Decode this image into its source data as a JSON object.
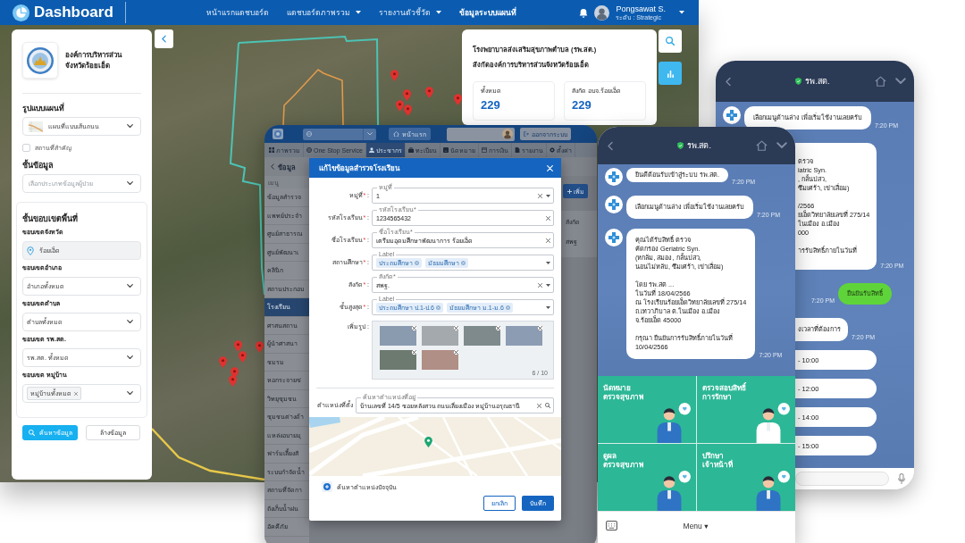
{
  "dashboard": {
    "title": "Dashboard",
    "nav": [
      {
        "label": "หน้าแรกแดชบอร์ด",
        "dropdown": false,
        "selected": false
      },
      {
        "label": "แดชบอร์ดภาพรวม",
        "dropdown": true,
        "selected": false
      },
      {
        "label": "รายงานตัวชี้วัด",
        "dropdown": true,
        "selected": false
      },
      {
        "label": "ข้อมูลระบบแผนที่",
        "dropdown": false,
        "selected": true
      }
    ],
    "user": {
      "name": "Pongsawat S.",
      "role": "ระดับ : Strategic"
    },
    "panel": {
      "org_name": "องค์การบริหารส่วน\nจังหวัดร้อยเอ็ด",
      "map_style": {
        "label": "รูปแบบแผนที่",
        "value": "แผนที่แบบเส้นถนน"
      },
      "landmarks": {
        "label": "สถานที่สำคัญ",
        "checked": false
      },
      "layer": {
        "label": "ชั้นข้อมูล",
        "placeholder": "เลือกประเภทข้อมูลผู้ป่วย"
      },
      "boundary": {
        "title": "ชั้นขอบเขตพื้นที่",
        "fields": [
          {
            "kind": "fixed",
            "label": "ขอบเขตจังหวัด",
            "value": "ร้อยเอ็ด"
          },
          {
            "kind": "select",
            "label": "ขอบเขตอำเภอ",
            "value": "อำเภอทั้งหมด"
          },
          {
            "kind": "select",
            "label": "ขอบเขตตำบล",
            "value": "ตำบลทั้งหมด"
          },
          {
            "kind": "select",
            "label": "ขอบเขต รพ.สต.",
            "value": "รพ.สต. ทั้งหมด"
          },
          {
            "kind": "chips",
            "label": "ขอบเขต หมู่บ้าน",
            "chips": [
              "หมู่บ้านทั้งหมด"
            ]
          }
        ]
      },
      "buttons": [
        {
          "kind": "primary",
          "label": "ค้นหาข้อมูล"
        },
        {
          "kind": "secondary",
          "label": "ล้างข้อมูล"
        }
      ]
    },
    "info_card": {
      "title": "โรงพยาบาลส่งเสริมสุขภาพตำบล (รพ.สต.)\nสังกัดองค์การบริหารส่วนจังหวัดร้อยเอ็ด",
      "stats": [
        {
          "label": "ทั้งหมด",
          "value": "229"
        },
        {
          "label": "สังกัด อบจ.ร้อยเอ็ด",
          "value": "229"
        }
      ]
    }
  },
  "web_app": {
    "home_button": "หน้าแรก",
    "logout_button": "ออกจากระบบ",
    "tabs": [
      {
        "label": "ภาพรวม",
        "selected": false
      },
      {
        "label": "One Stop Service",
        "selected": false
      },
      {
        "label": "ประชากร",
        "selected": true
      },
      {
        "label": "ทะเบียน",
        "selected": false
      },
      {
        "label": "นัดหมาย",
        "selected": false
      },
      {
        "label": "การเงิน",
        "selected": false
      },
      {
        "label": "รายงาน",
        "selected": false
      },
      {
        "label": "ตั้งค่า",
        "selected": false
      }
    ],
    "page_title": "ข้อมูล",
    "menu_header": "เมนู",
    "menu": [
      {
        "label": "ข้อมูลสำรวจ",
        "selected": false
      },
      {
        "label": "แพทย์ประจำ",
        "selected": false
      },
      {
        "label": "ศูนย์สาธารณ",
        "selected": false
      },
      {
        "label": "ศูนย์พัฒนาเ",
        "selected": false
      },
      {
        "label": "คลินิก",
        "selected": false
      },
      {
        "label": "สถานประกอบ",
        "selected": false
      },
      {
        "label": "โรงเรียน",
        "selected": true
      },
      {
        "label": "ศาสนสถาน",
        "selected": false
      },
      {
        "label": "ผู้นำศาสนา",
        "selected": false
      },
      {
        "label": "ชมรม",
        "selected": false
      },
      {
        "label": "หอกระจายข่",
        "selected": false
      },
      {
        "label": "วิทยุชุมชน",
        "selected": false
      },
      {
        "label": "ชุมชนต่างด้า",
        "selected": false
      },
      {
        "label": "แหล่งอบายมุ",
        "selected": false
      },
      {
        "label": "ฟาร์มเลี้ยงสั",
        "selected": false
      },
      {
        "label": "ระบบกำจัดน้ำ",
        "selected": false
      },
      {
        "label": "สถานที่จัดกา",
        "selected": false
      },
      {
        "label": "ถังเก็บน้ำฝน",
        "selected": false
      },
      {
        "label": "อัคคีภัย",
        "selected": false
      }
    ],
    "add_button": "เพิ่ม",
    "table": {
      "columns": [
        "สังกัด"
      ],
      "rows": [
        [
          "สพฐ"
        ]
      ]
    },
    "modal": {
      "title": "แก้ไขข้อมูลสำรวจโรงเรียน",
      "fields": [
        {
          "kind": "select",
          "label": "หมู่ที่",
          "mark": "*",
          "colon": ":",
          "float_label": "หมู่ที่",
          "value": "1"
        },
        {
          "kind": "text",
          "label": "รหัสโรงเรียน",
          "mark": "*",
          "colon": ":",
          "float_label": "รหัสโรงเรียน*",
          "value": "1234565432"
        },
        {
          "kind": "text",
          "label": "ชื่อโรงเรียน",
          "mark": "*",
          "colon": ":",
          "float_label": "ชื่อโรงเรียน*",
          "value": "เตรียมอุดมศึกษาพัฒนาการ ร้อยเอ็ด"
        },
        {
          "kind": "tags",
          "label": "สถานศึกษา",
          "mark": "*",
          "colon": ":",
          "float_label": "Label",
          "chips": [
            "ประถมศึกษา",
            "มัธยมศึกษา"
          ]
        },
        {
          "kind": "select",
          "label": "สังกัด",
          "mark": "*",
          "colon": ":",
          "float_label": "สังกัด*",
          "value": "สพฐ."
        },
        {
          "kind": "tags",
          "label": "ชั้นสูงสุด",
          "mark": "*",
          "colon": ":",
          "float_label": "Label",
          "chips": [
            "ประถมศึกษา ป.1-ป.6",
            "มัธยมศึกษา ม.1-ม.6"
          ]
        }
      ],
      "photos": {
        "label": "เพิ่มรูป",
        "colon": ":",
        "items": [
          {
            "removable": true
          },
          {
            "removable": true
          },
          {
            "removable": true
          },
          {
            "removable": true
          },
          {
            "removable": true
          },
          {
            "removable": true
          }
        ],
        "counter": "6 / 10"
      },
      "location": {
        "label": "ตำแหน่งที่ตั้ง",
        "float_label": "ค้นหาตำแหน่งที่อยู่",
        "value": "บ้านเลขที่ 14/5 ซอยหลังสวน ถนนเลี่ยงเมือง หมู่บ้านอรุณธานี"
      },
      "current_location": "ค้นหาตำแหน่งปัจจุบัน",
      "buttons": [
        {
          "kind": "secondary",
          "label": "ยกเลิก"
        },
        {
          "kind": "primary",
          "label": "บันทึก"
        }
      ]
    }
  },
  "chat_phone": {
    "title": "รพ.สต.",
    "messages": [
      {
        "kind": "bot",
        "text": "ยินดีต้อนรับเข้าสู่ระบบ รพ.สต.",
        "time": "7:20 PM"
      },
      {
        "kind": "bot",
        "text": "เลือกเมนูด้านล่าง เพื่อเริ่มใช้งานเลยครับ",
        "time": "7:20 PM"
      },
      {
        "kind": "bot",
        "text": "คุณได้รับสิทธิ์ ตรวจ\nคัดกรอง Geriatric Syn.\n(หกล้ม, สมอง, กลั้นปสว,\nนอนไม่หลับ, ซึมเศร้า, เข่าเสื่อม)\n\nโดย รพ.สต ...\nในวันที่ 18/04/2566\nณ โรงเรียนร้อยเอ็ดวิทยาลัยเลขที่ 275/14\nถ.เทวาภิบาล ต.ในเมือง อ.เมือง\nจ.ร้อยเอ็ด 45000\n\nกรุณา ยืนยันการรับสิทธิ์ภายในวันที่\n10/04/2566",
        "time": "7:20 PM"
      }
    ],
    "rich_menu": [
      "นัดหมาย\nตรวจสุขภาพ",
      "ตรวจสอบสิทธิ์\nการรักษา",
      "ดูผล\nตรวจสุขภาพ",
      "ปรึกษา\nเจ้าหน้าที่"
    ],
    "menu_label": "Menu ▾"
  },
  "confirm_phone": {
    "title": "รพ.สต.",
    "messages": [
      {
        "kind": "bot",
        "text": "เลือกเมนูด้านล่าง เพื่อเริ่มใช้งานเลยครับ",
        "time": "7:20 PM"
      },
      {
        "kind": "fragment",
        "text": "ตรวจ\niatric Syn.\n, กลั้นปสว,\nซึมเศร้า, เข่าเสื่อม)\n\n/2566\nยเอ็ดวิทยาลัยเลขที่ 275/14\nในเมือง อ.เมือง\n000\n\nารรับสิทธิ์ภายในวันที่",
        "time": "7:20 PM"
      },
      {
        "kind": "user",
        "text": "ยืนยันรับสิทธิ์",
        "time": "7:20 PM"
      },
      {
        "kind": "fragment",
        "text": "งเวลาที่ต้องการ",
        "time": "7:20 PM"
      }
    ],
    "options": [
      "- 10:00",
      "- 12:00",
      "- 14:00",
      "- 15:00"
    ]
  }
}
